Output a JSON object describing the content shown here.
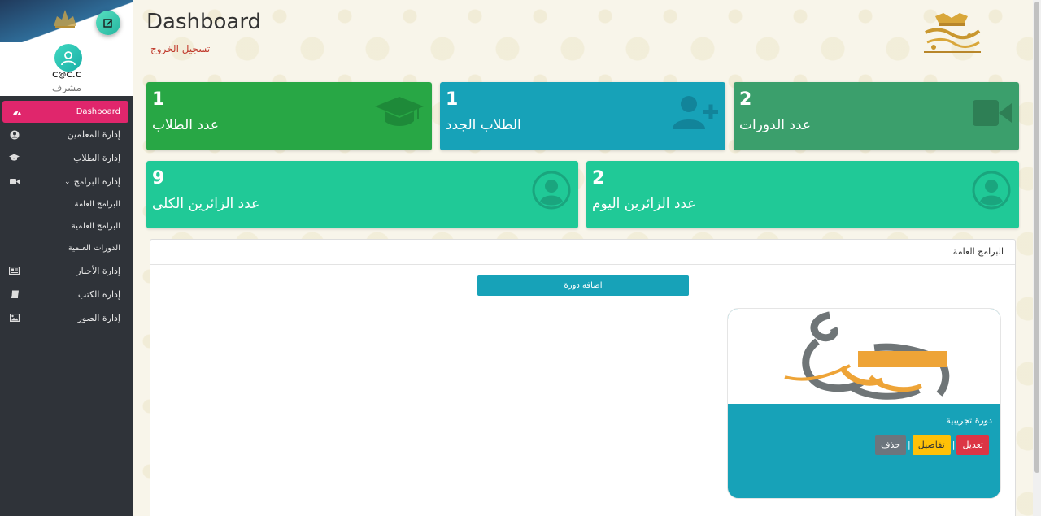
{
  "sidebar": {
    "user_name": "C@C.C",
    "user_role": "مشرف",
    "items": [
      {
        "label": "Dashboard",
        "icon": "dashboard-icon"
      },
      {
        "label": "إدارة المعلمين",
        "icon": "user-circle-icon"
      },
      {
        "label": "إدارة الطلاب",
        "icon": "graduation-cap-icon"
      },
      {
        "label": "إدارة البرامج",
        "icon": "video-icon"
      },
      {
        "label": "البرامج العامة"
      },
      {
        "label": "البرامج العلمية"
      },
      {
        "label": "الدورات العلمية"
      },
      {
        "label": "إدارة الأخبار",
        "icon": "newspaper-icon"
      },
      {
        "label": "إدارة الكتب",
        "icon": "book-icon"
      },
      {
        "label": "إدارة الصور",
        "icon": "image-icon"
      }
    ]
  },
  "header": {
    "title": "Dashboard",
    "logout": "تسجيل الخروج"
  },
  "stats": [
    {
      "value": "1",
      "label": "عدد الطلاب",
      "icon": "graduation-cap-icon",
      "color": "#28a745"
    },
    {
      "value": "1",
      "label": "الطلاب الجدد",
      "icon": "user-plus-icon",
      "color": "#17a2b8"
    },
    {
      "value": "2",
      "label": "عدد الدورات",
      "icon": "video-icon",
      "color": "#3b9f6c"
    },
    {
      "value": "9",
      "label": "عدد الزائرين الكلى",
      "icon": "user-circle-icon",
      "color": "#20c997"
    },
    {
      "value": "2",
      "label": "عدد الزائرين اليوم",
      "icon": "user-circle-icon",
      "color": "#20c997"
    }
  ],
  "panel": {
    "title": "البرامج العامة",
    "add_button": "اضافة دورة",
    "course": {
      "name": "دورة تجريبية",
      "edit": "تعديل",
      "details": "تفاصيل",
      "delete": "حذف",
      "separator": "|"
    }
  }
}
